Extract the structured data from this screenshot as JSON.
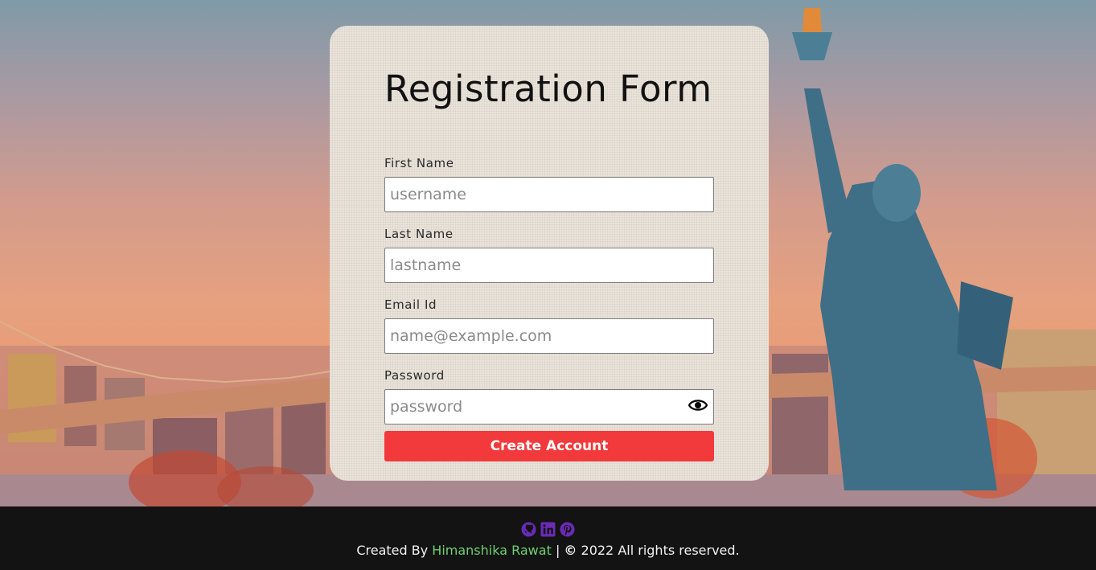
{
  "form": {
    "title": "Registration Form",
    "fields": [
      {
        "label": "First Name",
        "placeholder": "username",
        "value": ""
      },
      {
        "label": "Last Name",
        "placeholder": "lastname",
        "value": ""
      },
      {
        "label": "Email Id",
        "placeholder": "name@example.com",
        "value": ""
      },
      {
        "label": "Password",
        "placeholder": "password",
        "value": ""
      }
    ],
    "submit_label": "Create Account",
    "show_password_icon": "eye-icon"
  },
  "footer": {
    "social_icons": [
      "github-icon",
      "linkedin-icon",
      "pinterest-icon"
    ],
    "created_by": "Created By",
    "author": "Himanshika Rawat",
    "separator": "|",
    "copyright_symbol": "©",
    "rights": "2022 All rights reserved."
  },
  "colors": {
    "accent": "#f2393b",
    "author_link": "#6fd06f",
    "social_icon": "#6a2bb5",
    "footer_bg": "#131314"
  }
}
